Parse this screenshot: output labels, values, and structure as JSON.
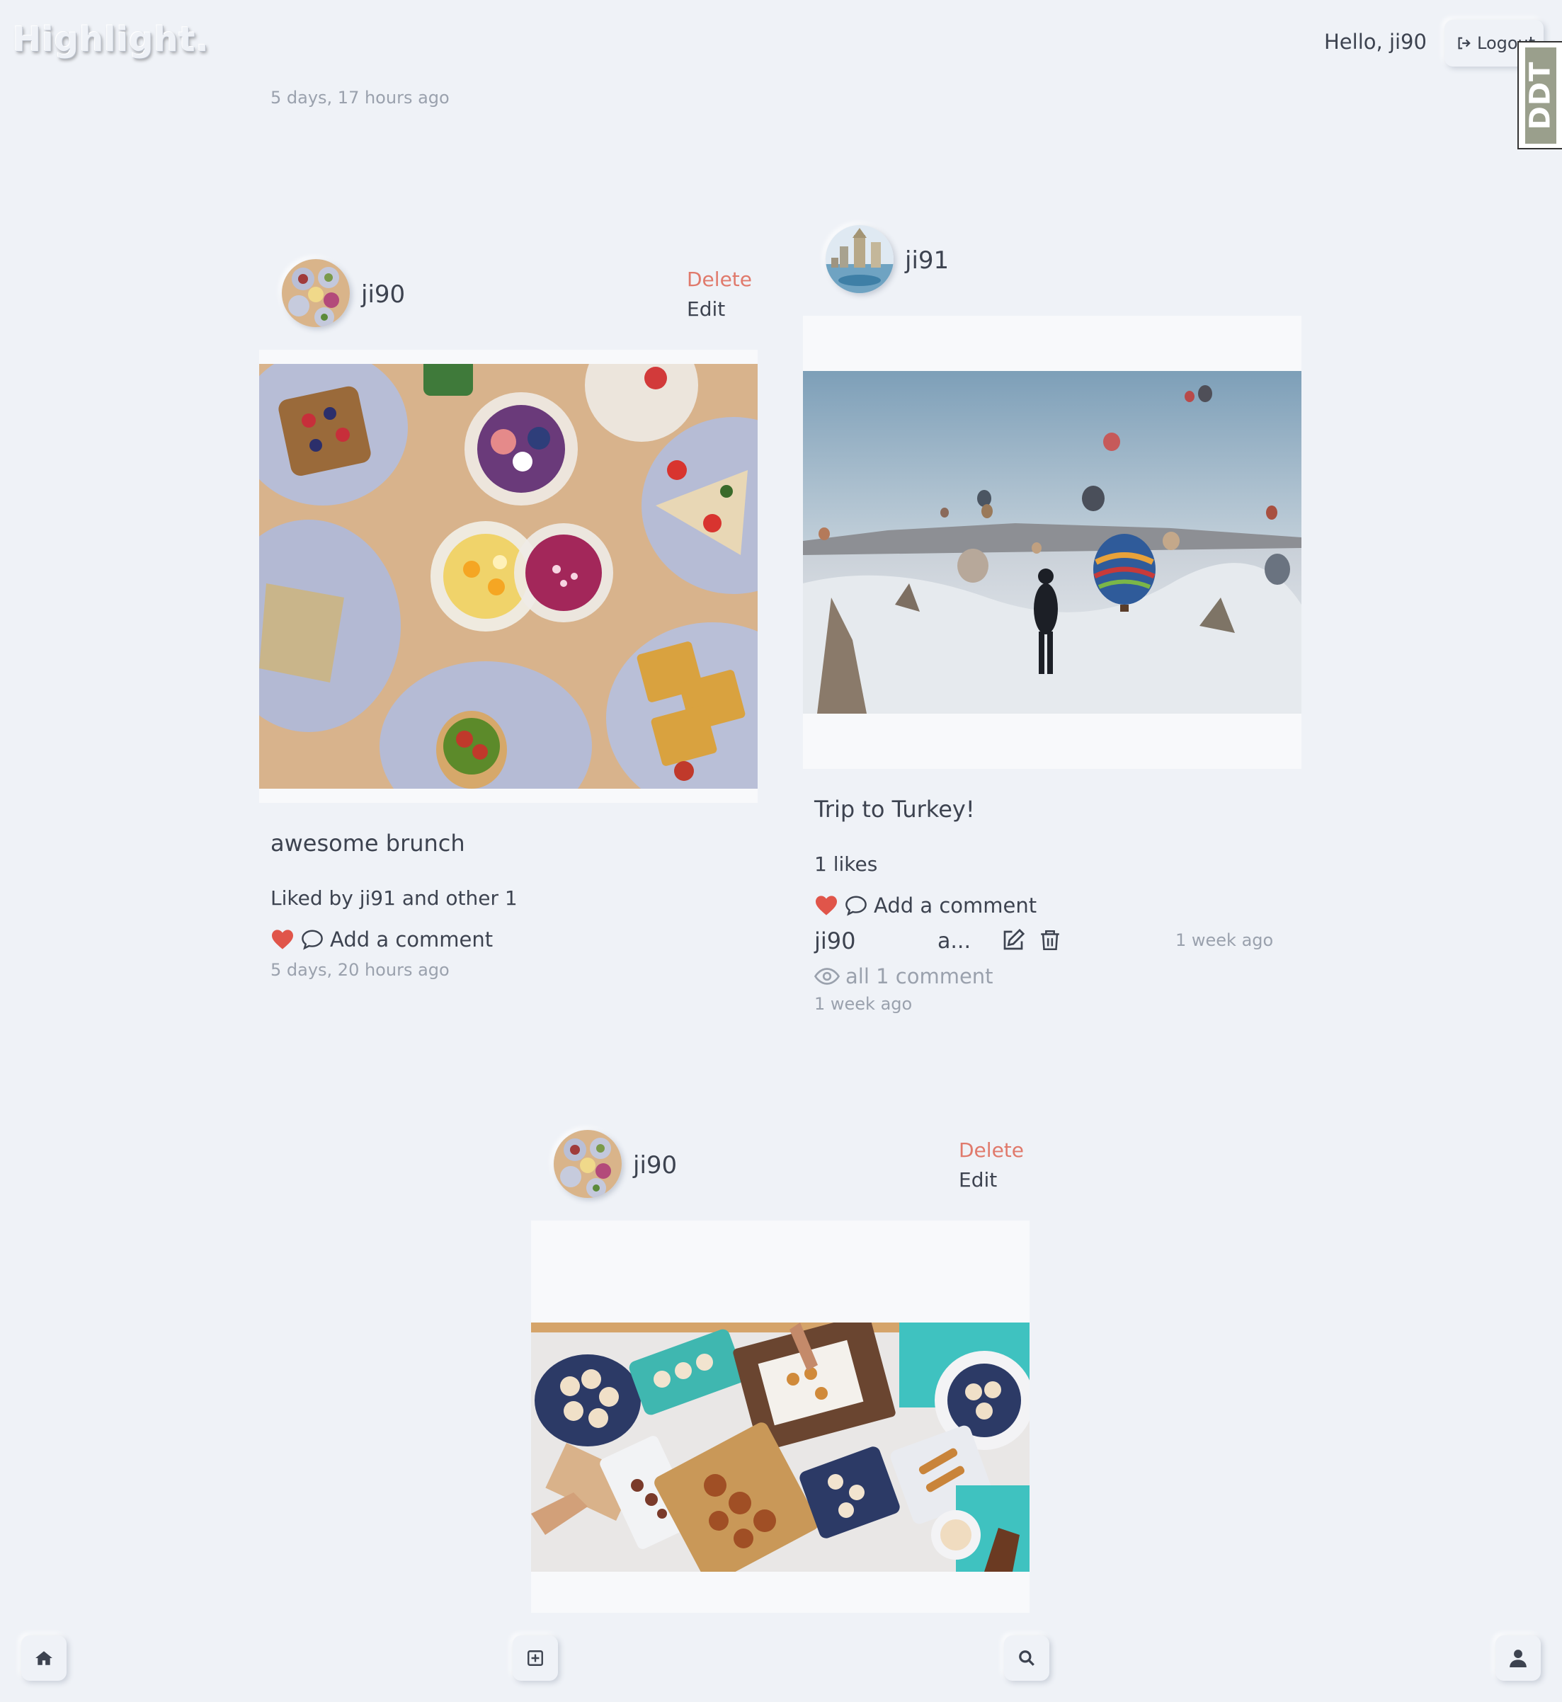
{
  "header": {
    "logo": "Highlight.",
    "greeting": "Hello, ji90",
    "logout_label": "Logout",
    "badge_text": "DDT"
  },
  "top_timestamp": "5 days, 17 hours ago",
  "posts": [
    {
      "username": "ji90",
      "delete_label": "Delete",
      "edit_label": "Edit",
      "caption": "awesome brunch",
      "likes_text": "Liked by ji91 and other 1",
      "add_comment_label": "Add a comment",
      "timestamp": "5 days, 20 hours ago"
    },
    {
      "username": "ji91",
      "caption": "Trip to Turkey!",
      "likes_text": "1 likes",
      "add_comment_label": "Add a comment",
      "comment": {
        "author": "ji90",
        "text": "a...",
        "time": "1 week ago"
      },
      "view_all_label": "all 1 comment",
      "timestamp": "1 week ago"
    },
    {
      "username": "ji90",
      "delete_label": "Delete",
      "edit_label": "Edit"
    }
  ],
  "colors": {
    "background": "#eff2f7",
    "heart": "#e0554a",
    "delete": "#e07a6c",
    "muted": "#9aa1ad"
  },
  "icons": [
    "logout-icon",
    "heart-icon",
    "comment-icon",
    "edit-icon",
    "trash-icon",
    "eye-icon",
    "home-icon",
    "plus-square-icon",
    "search-icon",
    "user-icon"
  ]
}
